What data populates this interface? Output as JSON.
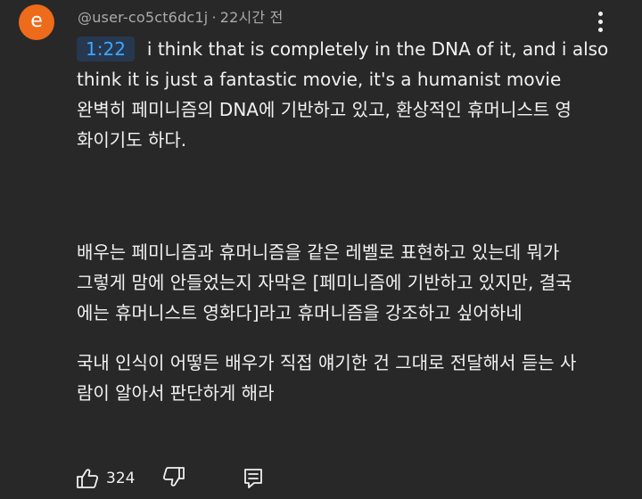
{
  "comment": {
    "avatar_letter": "e",
    "avatar_color": "#ee6b1c",
    "username": "@user-co5ct6dc1j",
    "separator": "·",
    "time_ago": "22시간 전",
    "menu_icon": "more-vert-icon",
    "timestamp_link": "1:22",
    "lines": [
      "i think that is completely in the DNA of it, and i also",
      "think it is just a fantastic movie, it's a humanist movie",
      "완벽히 페미니즘의 DNA에 기반하고 있고, 환상적인 휴머니스트 영",
      "화이기도 하다.",
      "배우는 페미니즘과 휴머니즘을 같은 레벨로 표현하고 있는데 뭐가",
      "그렇게 맘에 안들었는지 자막은 [페미니즘에 기반하고 있지만, 결국",
      "에는 휴머니스트 영화다]라고 휴머니즘을 강조하고 싶어하네",
      "국내 인식이 어떻든 배우가 직접 얘기한 건 그대로 전달해서 듣는 사",
      "람이 알아서 판단하게 해라"
    ]
  },
  "actions": {
    "like_icon": "thumbs-up-icon",
    "like_count": "324",
    "dislike_icon": "thumbs-down-icon",
    "reply_icon": "reply-comment-icon"
  },
  "colors": {
    "background": "#282828",
    "text": "#f1f1f1",
    "meta_text": "#aaaaaa",
    "link": "#3ea6ff",
    "link_background": "#263850"
  }
}
